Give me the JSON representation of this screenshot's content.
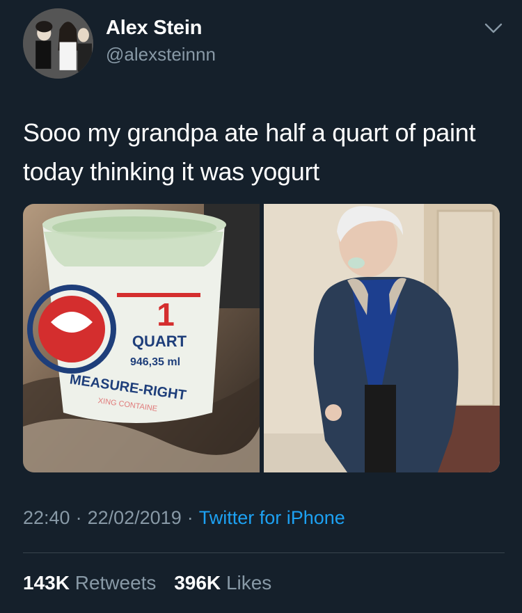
{
  "tweet": {
    "author": {
      "display_name": "Alex Stein",
      "handle": "@alexsteinnn",
      "avatar_icon": "avatar-photo-icon"
    },
    "menu_icon": "chevron-down-icon",
    "text": "Sooo my grandpa ate half a quart of paint today thinking it was yogurt",
    "media": {
      "left_photo": {
        "label_number": "1",
        "label_unit": "QUART",
        "label_volume": "946,35 ml",
        "label_brand": "MEASURE-RIGHT",
        "label_tagline": "XING CONTAINE"
      },
      "right_photo_icon": "grandpa-photo-icon"
    },
    "time": "22:40",
    "date": "22/02/2019",
    "source": "Twitter for iPhone",
    "retweets_count": "143K",
    "retweets_label": "Retweets",
    "likes_count": "396K",
    "likes_label": "Likes",
    "colors": {
      "background": "#15202b",
      "secondary_text": "#8899a6",
      "link": "#1da1f2",
      "divider": "#38444d"
    }
  }
}
